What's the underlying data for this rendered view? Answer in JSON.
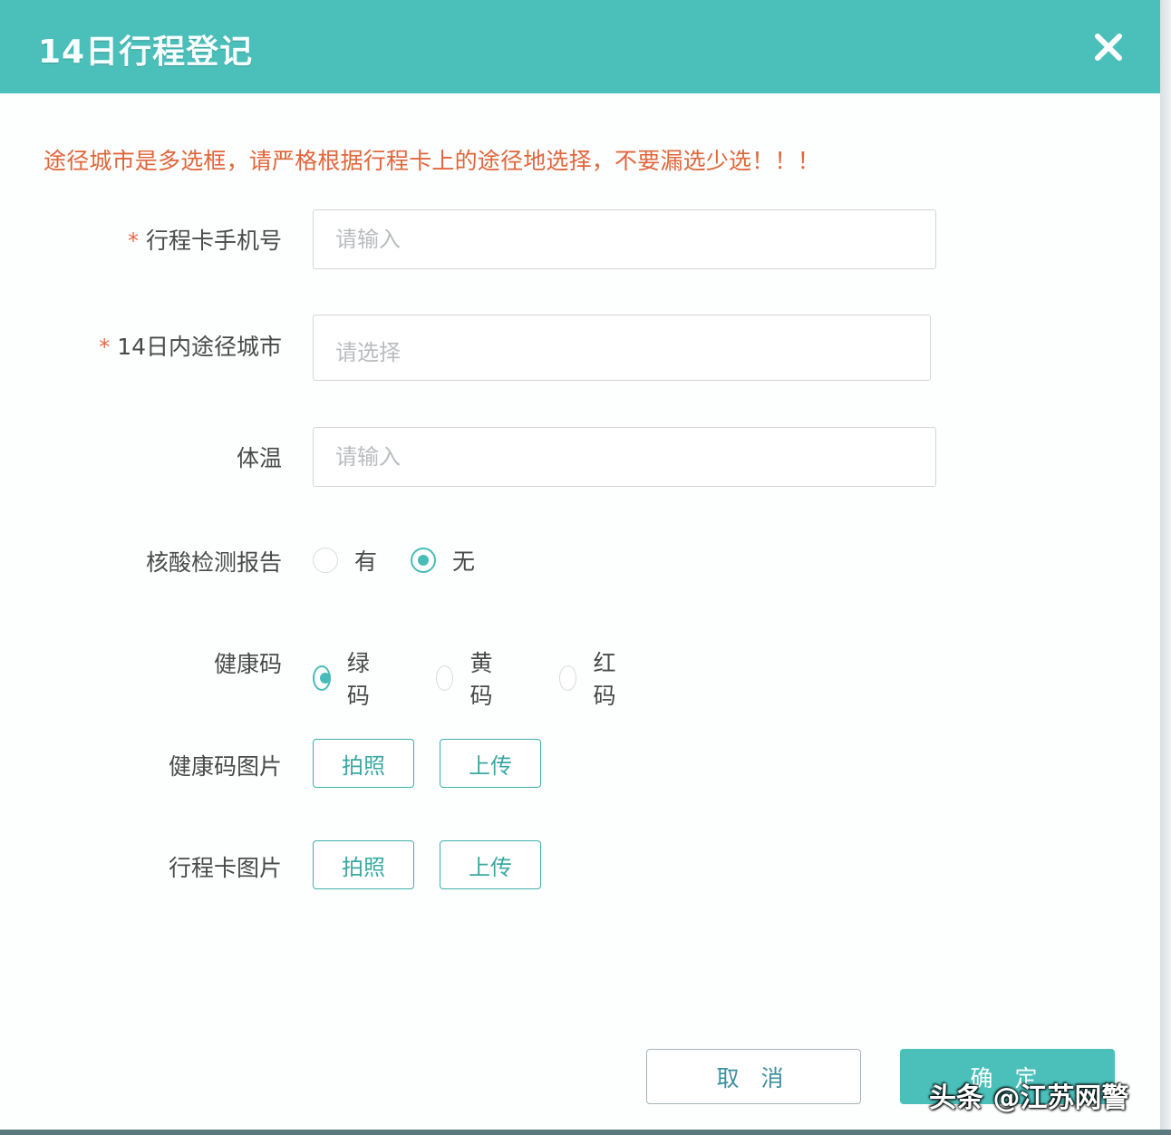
{
  "dialog": {
    "title": "14日行程登记",
    "warning": "途径城市是多选框，请严格根据行程卡上的途径地选择，不要漏选少选！！！"
  },
  "form": {
    "phone": {
      "required_mark": "*",
      "label": "行程卡手机号",
      "placeholder": "请输入",
      "value": ""
    },
    "cities": {
      "required_mark": "*",
      "label": "14日内途径城市",
      "placeholder": "请选择"
    },
    "temperature": {
      "label": "体温",
      "placeholder": "请输入",
      "value": ""
    },
    "nucleic_report": {
      "label": "核酸检测报告",
      "options": [
        "有",
        "无"
      ],
      "selected": "无"
    },
    "health_code": {
      "label": "健康码",
      "options": [
        "绿码",
        "黄码",
        "红码"
      ],
      "selected": "绿码"
    },
    "health_code_image": {
      "label": "健康码图片",
      "photo": "拍照",
      "upload": "上传"
    },
    "trip_card_image": {
      "label": "行程卡图片",
      "photo": "拍照",
      "upload": "上传"
    }
  },
  "footer": {
    "cancel": "取 消",
    "confirm": "确 定"
  },
  "watermark": "头条 @江苏网警",
  "colors": {
    "accent": "#4bbfba",
    "warning": "#e0663c",
    "required": "#e36b4a"
  },
  "icons": {
    "close": "close-icon"
  }
}
